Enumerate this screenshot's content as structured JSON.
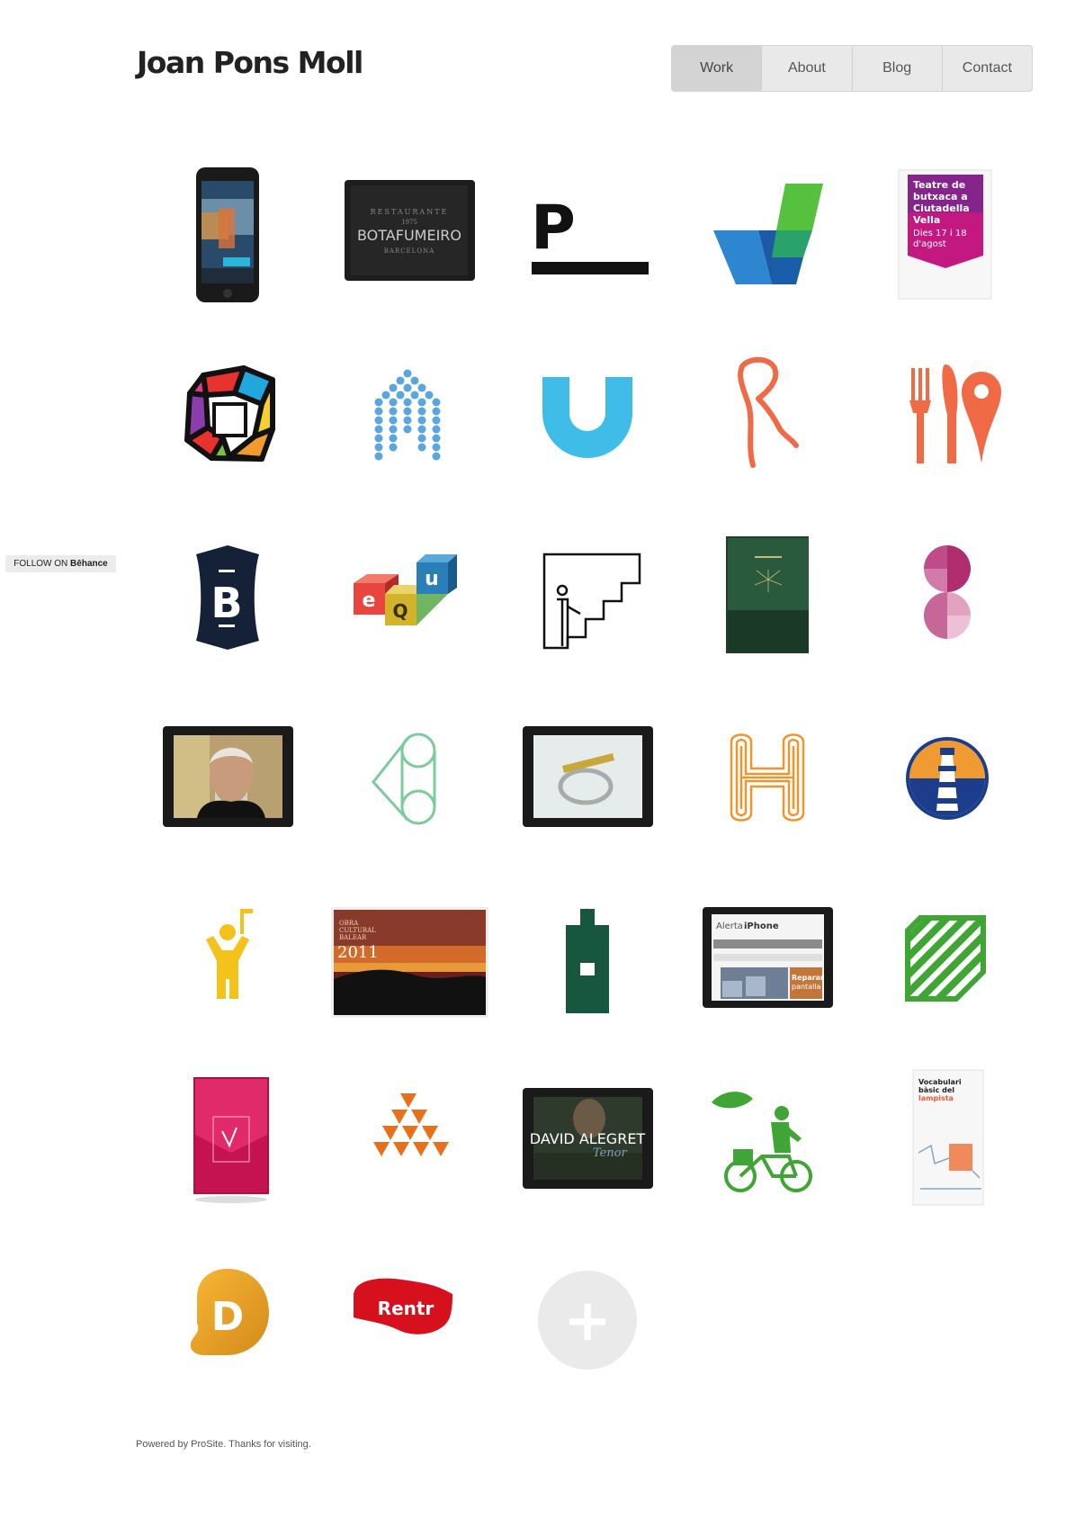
{
  "header": {
    "site_title": "Joan Pons Moll"
  },
  "nav": {
    "items": [
      "Work",
      "About",
      "Blog",
      "Contact"
    ],
    "active": "Work"
  },
  "behance": {
    "prefix": "FOLLOW ON",
    "brand": "Bēhance"
  },
  "portfolio": {
    "item_names": [
      "phone-weather-app",
      "botafumeiro-tablet",
      "p-logo",
      "blue-green-checkmark-logo",
      "teatre-de-butxaca-poster",
      "colorful-square-logo",
      "blue-dots-logo",
      "cyan-d-logo",
      "orange-r-logo",
      "fork-knife-pin-logo",
      "b-badge-logo",
      "equ-blocks-logo",
      "stairs-figure-logo",
      "binatram-book",
      "purple-s-logo",
      "portrait-tablet",
      "green-outline-logo",
      "ring-tablet",
      "orange-h-logo",
      "lighthouse-emblem",
      "yellow-figure-logo",
      "obra-cultural-balear-site",
      "green-building-logo",
      "alertaiphone-tablet",
      "green-stripes-logo",
      "red-packaging",
      "orange-triangles-logo",
      "david-alegret-tablet",
      "cyclist-leaf-logo",
      "vocabulari-booklet",
      "orange-d-logo",
      "rentr-logo",
      "add-project-button"
    ],
    "texts": {
      "botafumeiro": {
        "top": "RESTAURANTE",
        "year": "1975",
        "name": "BOTAFUMEIRO",
        "city": "BARCELONA"
      },
      "p_logo": "P",
      "teatre": {
        "title_lines": [
          "Teatre de",
          "butxaca a",
          "Ciutadella",
          "Vella"
        ],
        "date_lines": [
          "Dies 17 i 18",
          "d'agost"
        ]
      },
      "equ": [
        "e",
        "Q",
        "u"
      ],
      "b_logo": "B",
      "obra": {
        "lines": [
          "OBRA",
          "CULTURAL",
          "BALEAR"
        ],
        "year": "2011"
      },
      "alerta": {
        "title_plain": "Alerta",
        "title_bold": "iPhone",
        "repair": "Reparar",
        "screen": "pantalla"
      },
      "david": {
        "name": "DAVID ALEGRET",
        "subtitle": "Tenor"
      },
      "vocab": {
        "lines": [
          "Vocabulari",
          "bàsic del"
        ],
        "accent": "lampista"
      },
      "d_logo": "D",
      "rentr": "Rentr",
      "add_symbol": "+"
    }
  },
  "footer": {
    "text": "Powered by ProSite. Thanks for visiting."
  },
  "colors": {
    "orange": "#ef6a45",
    "blue_dots": "#5aa6e0",
    "cyan": "#3fbde8",
    "navy": "#152137",
    "dark_green": "#17573f",
    "bright_green": "#3fa535",
    "yellow": "#f3c21b",
    "magenta": "#d0185b",
    "red": "#d7101e"
  }
}
